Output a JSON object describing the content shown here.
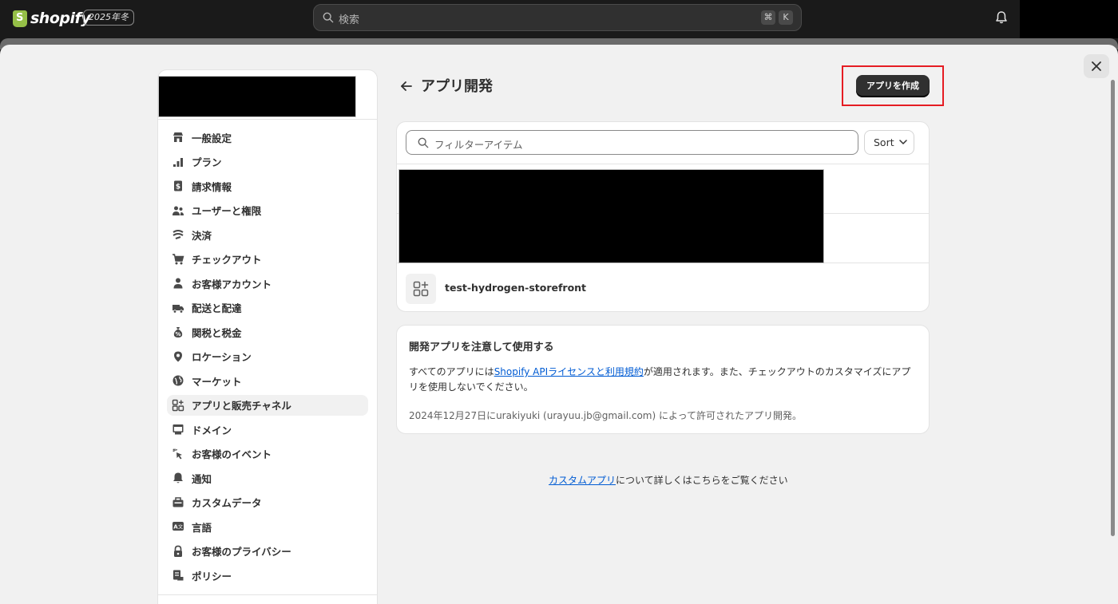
{
  "topbar": {
    "logo_text": "shopify",
    "edition_badge": "2025年冬",
    "search_placeholder": "検索",
    "shortcut_cmd": "⌘",
    "shortcut_key": "K"
  },
  "sidebar": {
    "items": [
      {
        "label": "一般設定",
        "icon": "store-icon"
      },
      {
        "label": "プラン",
        "icon": "plan-chart-icon"
      },
      {
        "label": "請求情報",
        "icon": "receipt-icon"
      },
      {
        "label": "ユーザーと権限",
        "icon": "users-icon"
      },
      {
        "label": "決済",
        "icon": "payments-icon"
      },
      {
        "label": "チェックアウト",
        "icon": "cart-icon"
      },
      {
        "label": "お客様アカウント",
        "icon": "person-icon"
      },
      {
        "label": "配送と配達",
        "icon": "truck-icon"
      },
      {
        "label": "関税と税金",
        "icon": "money-bag-icon"
      },
      {
        "label": "ロケーション",
        "icon": "location-pin-icon"
      },
      {
        "label": "マーケット",
        "icon": "globe-icon"
      },
      {
        "label": "アプリと販売チャネル",
        "icon": "apps-icon",
        "active": true
      },
      {
        "label": "ドメイン",
        "icon": "domain-icon"
      },
      {
        "label": "お客様のイベント",
        "icon": "cursor-click-icon"
      },
      {
        "label": "通知",
        "icon": "bell-icon"
      },
      {
        "label": "カスタムデータ",
        "icon": "custom-data-icon"
      },
      {
        "label": "言語",
        "icon": "language-icon"
      },
      {
        "label": "お客様のプライバシー",
        "icon": "lock-icon"
      },
      {
        "label": "ポリシー",
        "icon": "policy-icon"
      }
    ]
  },
  "main": {
    "title": "アプリ開発",
    "create_button": "アプリを作成",
    "filter_placeholder": "フィルターアイテム",
    "sort_label": "Sort",
    "apps": [
      {
        "name": "test-hydrogen-storefront"
      }
    ],
    "info_card": {
      "title": "開発アプリを注意して使用する",
      "text_before": "すべてのアプリには",
      "link": "Shopify APIライセンスと利用規約",
      "text_after": "が適用されます。また、チェックアウトのカスタマイズにアプリを使用しないでください。",
      "note": "2024年12月27日にurakiyuki (urayuu.jb@gmail.com) によって許可されたアプリ開発。"
    },
    "footer": {
      "link": "カスタムアプリ",
      "text": "について詳しくはこちらをご覧ください"
    }
  },
  "colors": {
    "topbar_bg": "#1a1a1a",
    "sheet_bg": "#f1f1f1",
    "primary_button": "#303030",
    "link": "#005bd3",
    "highlight": "#e51c23"
  }
}
